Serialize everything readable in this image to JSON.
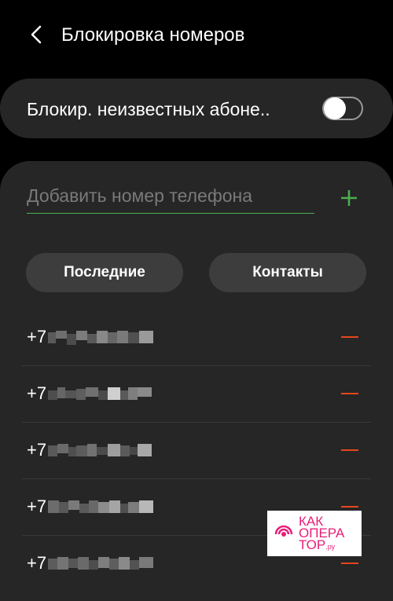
{
  "header": {
    "title": "Блокировка номеров",
    "back_icon": "chevron-left-icon"
  },
  "block_unknown": {
    "label": "Блокир. неизвестных абоне..",
    "enabled": false
  },
  "add_number": {
    "placeholder": "Добавить номер телефона",
    "add_icon": "plus-icon",
    "accent_color": "#4caf50"
  },
  "buttons": {
    "recent_label": "Последние",
    "contacts_label": "Контакты"
  },
  "blocked_numbers": [
    {
      "prefix": "+7"
    },
    {
      "prefix": "+7"
    },
    {
      "prefix": "+7"
    },
    {
      "prefix": "+7"
    },
    {
      "prefix": "+7"
    }
  ],
  "remove_color": "#e8461b",
  "watermark": {
    "line1": "КАК",
    "line2": "ОПЕРА",
    "line3": "ТОР",
    "suffix": ".ру",
    "color": "#e91e78"
  }
}
